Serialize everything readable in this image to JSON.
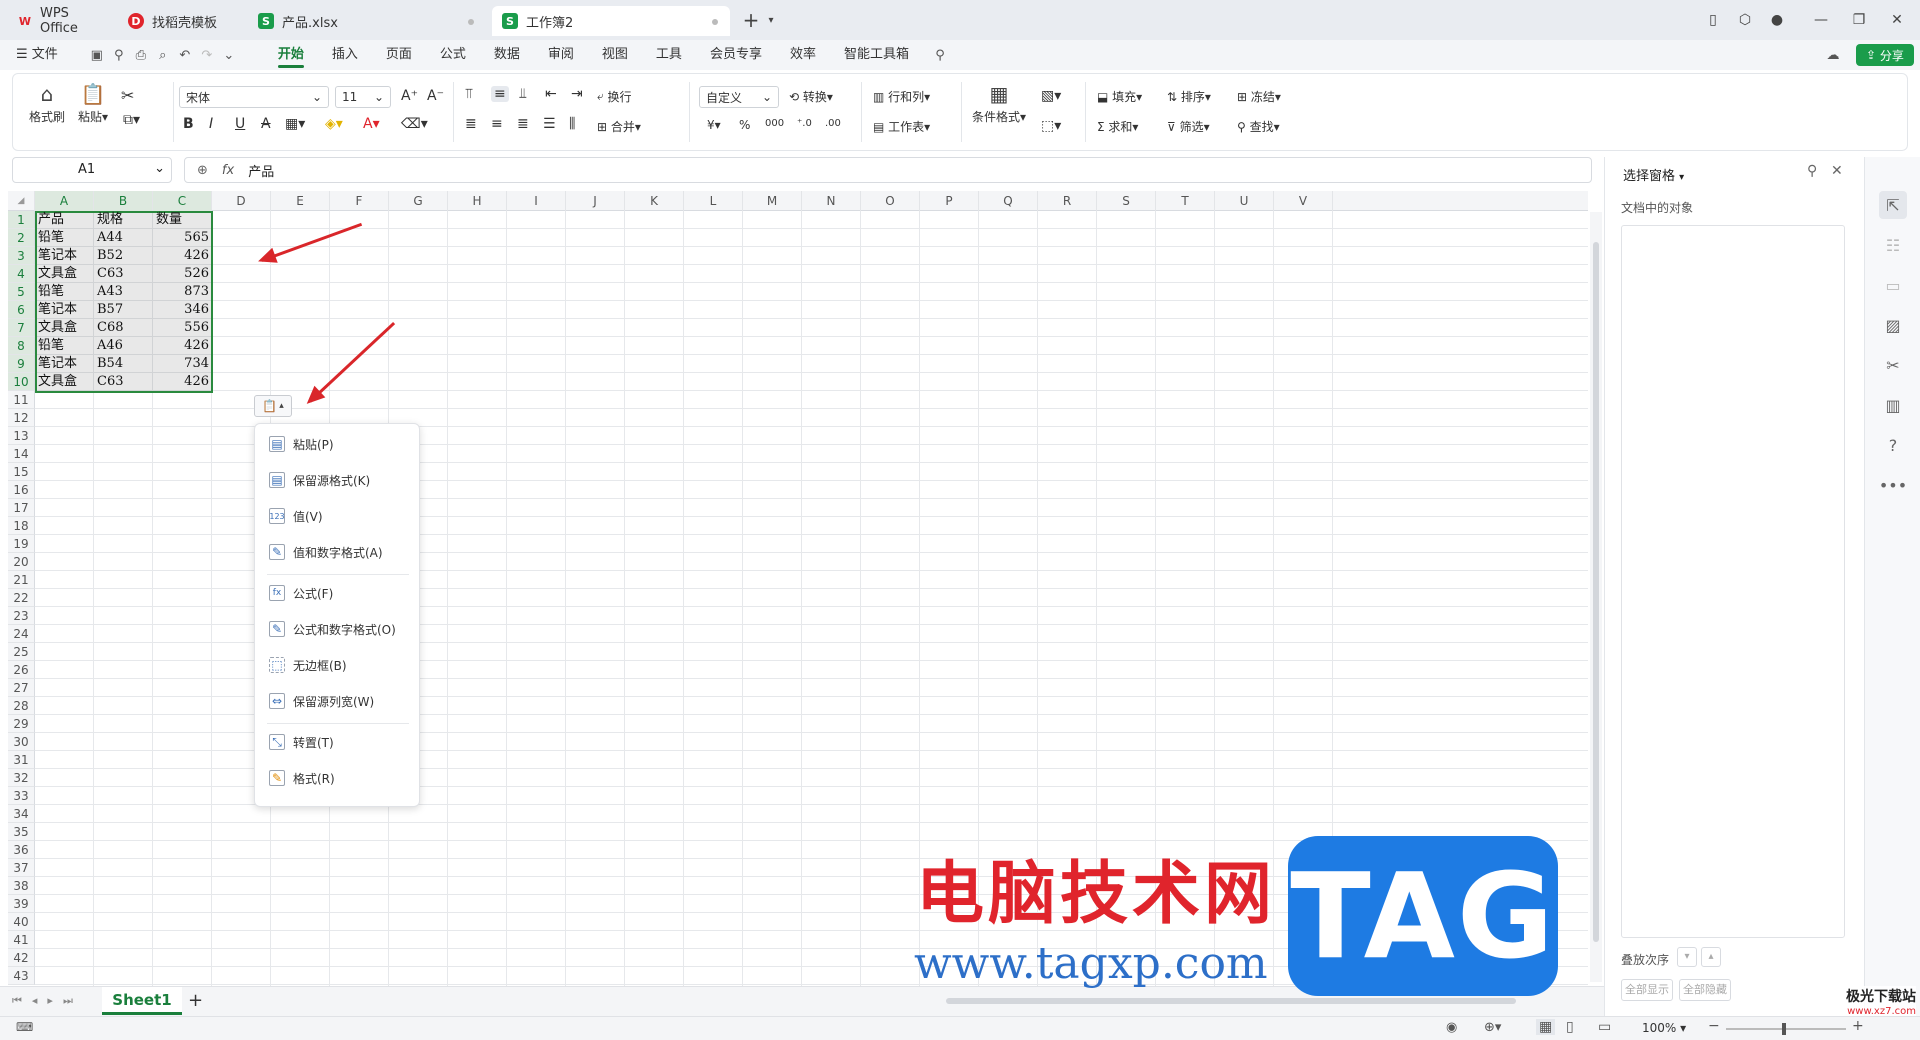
{
  "tabs": [
    {
      "label": "WPS Office",
      "icon": "wps-logo-icon",
      "color": "#e0242c"
    },
    {
      "label": "找稻壳模板",
      "icon": "docer-icon",
      "color": "#e0242c"
    },
    {
      "label": "产品.xlsx",
      "icon": "sheet-icon",
      "color": "#1a9c4b"
    },
    {
      "label": "工作簿2",
      "icon": "sheet-icon",
      "color": "#1a9c4b"
    }
  ],
  "menubar": {
    "file": "文件",
    "items": [
      "开始",
      "插入",
      "页面",
      "公式",
      "数据",
      "审阅",
      "视图",
      "工具",
      "会员专享",
      "效率",
      "智能工具箱"
    ],
    "share": "分享"
  },
  "ribbon": {
    "format_painter": "格式刷",
    "paste": "粘贴",
    "font": "宋体",
    "size": "11",
    "wrap": "换行",
    "merge": "合并",
    "numfmt": "自定义",
    "convert": "转换",
    "rowcol": "行和列",
    "worksheet": "工作表",
    "cond_format": "条件格式",
    "fill": "填充",
    "sort": "排序",
    "freeze": "冻结",
    "sum": "求和",
    "filter": "筛选",
    "find": "查找"
  },
  "formula": {
    "name_box": "A1",
    "fx": "fx",
    "content": "产品"
  },
  "columns": [
    "A",
    "B",
    "C",
    "D",
    "E",
    "F",
    "G",
    "H",
    "I",
    "J",
    "K",
    "L",
    "M",
    "N",
    "O",
    "P",
    "Q",
    "R",
    "S",
    "T",
    "U",
    "V"
  ],
  "table": [
    [
      "产品",
      "规格",
      "数量"
    ],
    [
      "铅笔",
      "A44",
      "565"
    ],
    [
      "笔记本",
      "B52",
      "426"
    ],
    [
      "文具盒",
      "C63",
      "526"
    ],
    [
      "铅笔",
      "A43",
      "873"
    ],
    [
      "笔记本",
      "B57",
      "346"
    ],
    [
      "文具盒",
      "C68",
      "556"
    ],
    [
      "铅笔",
      "A46",
      "426"
    ],
    [
      "笔记本",
      "B54",
      "734"
    ],
    [
      "文具盒",
      "C63",
      "426"
    ]
  ],
  "paste_menu": [
    {
      "label": "粘贴(P)"
    },
    {
      "label": "保留源格式(K)"
    },
    {
      "label": "值(V)"
    },
    {
      "label": "值和数字格式(A)"
    },
    {
      "label": "公式(F)"
    },
    {
      "label": "公式和数字格式(O)"
    },
    {
      "label": "无边框(B)"
    },
    {
      "label": "保留源列宽(W)"
    },
    {
      "label": "转置(T)"
    },
    {
      "label": "格式(R)"
    }
  ],
  "pane": {
    "title": "选择窗格",
    "subtitle": "文档中的对象",
    "order": "叠放次序",
    "show_all": "全部显示",
    "hide_all": "全部隐藏"
  },
  "sheet": {
    "name": "Sheet1"
  },
  "status": {
    "zoom": "100%"
  },
  "watermark": {
    "cn": "电脑技术网",
    "url": "www.tagxp.com",
    "tag": "TAG",
    "site": "极光下载站",
    "site_url": "www.xz7.com"
  },
  "colors": {
    "accent": "#1a7f3c",
    "selection": "#2a8a3e",
    "arrow": "#d9262a"
  }
}
